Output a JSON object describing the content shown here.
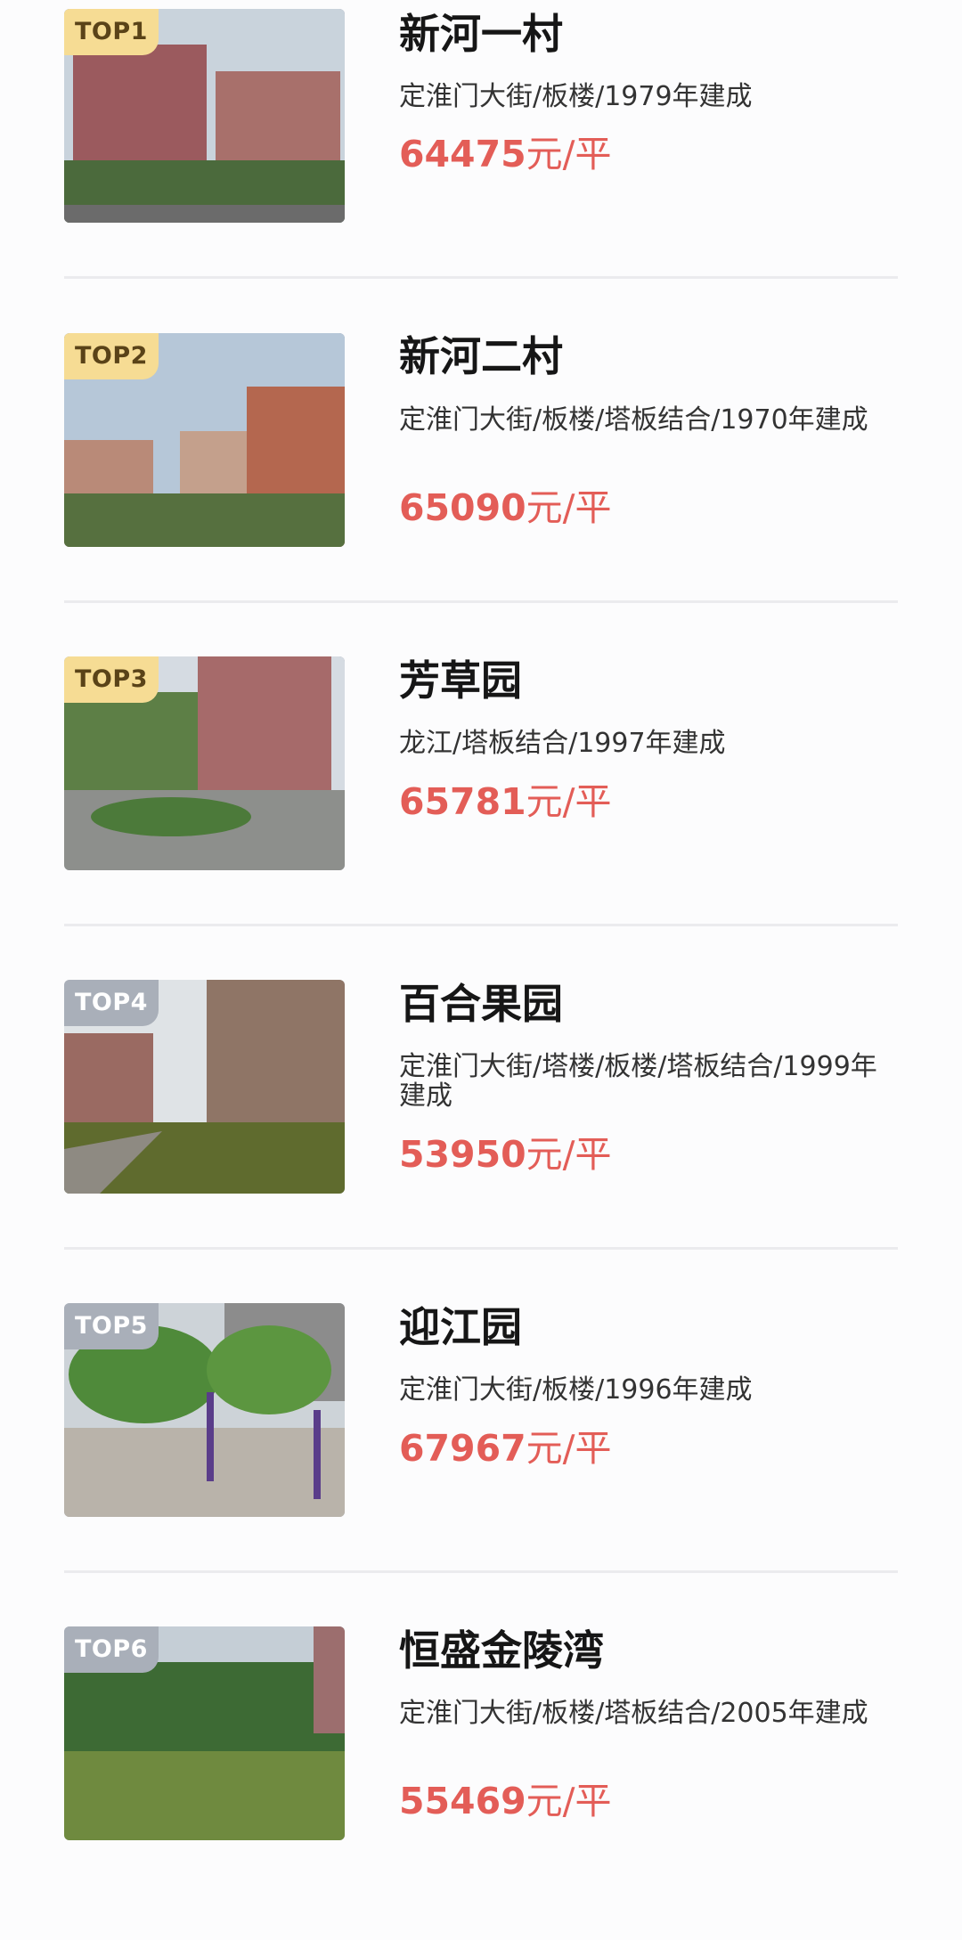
{
  "listings": [
    {
      "rank": "TOP1",
      "name": "新河一村",
      "details": "定淮门大街/板楼/1979年建成",
      "price": "64475",
      "unit": "元/平"
    },
    {
      "rank": "TOP2",
      "name": "新河二村",
      "details": "定淮门大街/板楼/塔板结合/1970年建成",
      "price": "65090",
      "unit": "元/平"
    },
    {
      "rank": "TOP3",
      "name": "芳草园",
      "details": "龙江/塔板结合/1997年建成",
      "price": "65781",
      "unit": "元/平"
    },
    {
      "rank": "TOP4",
      "name": "百合果园",
      "details": "定淮门大街/塔楼/板楼/塔板结合/1999年建成",
      "price": "53950",
      "unit": "元/平"
    },
    {
      "rank": "TOP5",
      "name": "迎江园",
      "details": "定淮门大街/板楼/1996年建成",
      "price": "67967",
      "unit": "元/平"
    },
    {
      "rank": "TOP6",
      "name": "恒盛金陵湾",
      "details": "定淮门大街/板楼/塔板结合/2005年建成",
      "price": "55469",
      "unit": "元/平"
    }
  ],
  "colors": {
    "price": "#e35d57",
    "badge_top3": "#f6dc94",
    "badge_rest": "#a9afb9"
  }
}
